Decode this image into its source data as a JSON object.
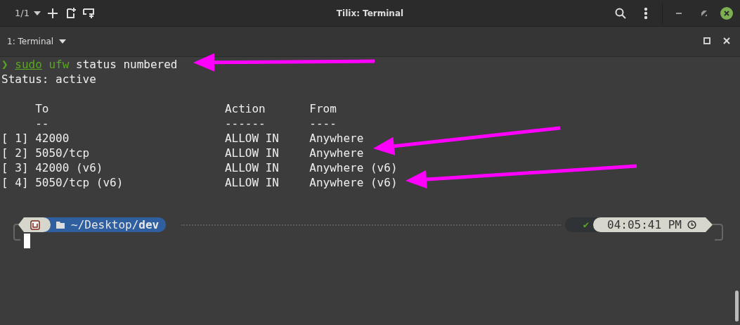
{
  "window": {
    "title": "Tilix: Terminal",
    "session": "1/1"
  },
  "tab": {
    "title": "1: Terminal"
  },
  "terminal": {
    "prompt_line": [
      {
        "text": "❯",
        "kind": "symbol"
      },
      {
        "text": "sudo",
        "kind": "command",
        "underlined": true
      },
      {
        "text": "ufw",
        "kind": "command",
        "underlined": false
      },
      {
        "text": "status numbered",
        "kind": "argument",
        "underlined": false
      }
    ],
    "status_line": "Status: active",
    "table": {
      "columns": [
        "To",
        "Action",
        "From"
      ],
      "rules": [
        "--",
        "------",
        "----"
      ],
      "rows": [
        {
          "index": "[ 1]",
          "to": "42000",
          "action": "ALLOW IN",
          "from": "Anywhere"
        },
        {
          "index": "[ 2]",
          "to": "5050/tcp",
          "action": "ALLOW IN",
          "from": "Anywhere"
        },
        {
          "index": "[ 3]",
          "to": "42000 (v6)",
          "action": "ALLOW IN",
          "from": "Anywhere (v6)"
        },
        {
          "index": "[ 4]",
          "to": "5050/tcp (v6)",
          "action": "ALLOW IN",
          "from": "Anywhere (v6)"
        }
      ]
    },
    "prompt": {
      "path": "~/Desktop/",
      "dir": "dev",
      "status": "✔",
      "time": "04:05:41 PM"
    }
  }
}
